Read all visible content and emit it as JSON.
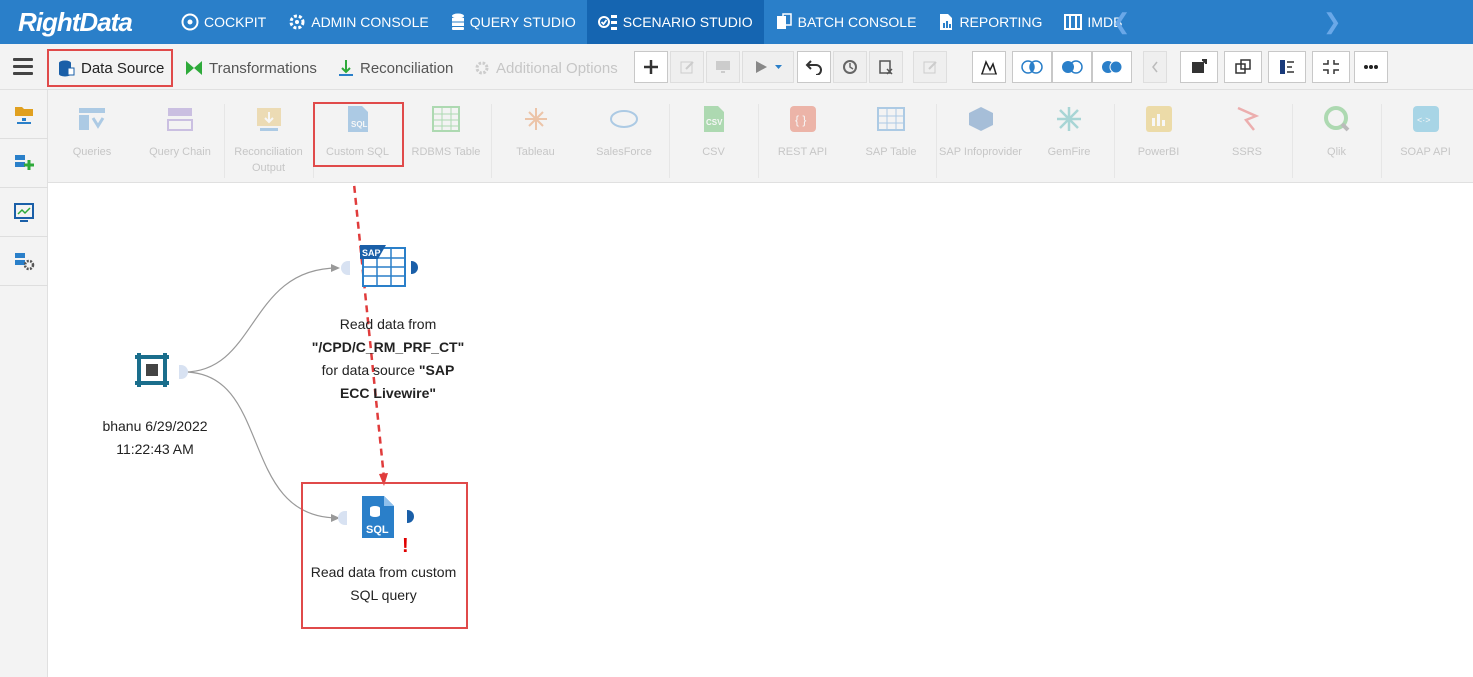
{
  "brand": {
    "logo_text": "RightData"
  },
  "nav": {
    "items": [
      {
        "label": "COCKPIT"
      },
      {
        "label": "ADMIN CONSOLE"
      },
      {
        "label": "QUERY STUDIO"
      },
      {
        "label": "SCENARIO STUDIO"
      },
      {
        "label": "BATCH CONSOLE"
      },
      {
        "label": "REPORTING"
      },
      {
        "label": "IMDB"
      }
    ],
    "active": "SCENARIO STUDIO"
  },
  "toolbar": {
    "data_source": "Data Source",
    "transformations": "Transformations",
    "reconciliation": "Reconciliation",
    "additional_options": "Additional Options"
  },
  "palette": {
    "items": [
      {
        "label": "Queries"
      },
      {
        "label": "Query Chain"
      },
      {
        "label": "Reconciliation Output"
      },
      {
        "label": "Custom SQL"
      },
      {
        "label": "RDBMS Table"
      },
      {
        "label": "Tableau"
      },
      {
        "label": "SalesForce"
      },
      {
        "label": "CSV"
      },
      {
        "label": "REST API"
      },
      {
        "label": "SAP Table"
      },
      {
        "label": "SAP Infoprovider"
      },
      {
        "label": "GemFire"
      },
      {
        "label": "PowerBI"
      },
      {
        "label": "SSRS"
      },
      {
        "label": "Qlik"
      },
      {
        "label": "SOAP API"
      }
    ]
  },
  "canvas": {
    "start_node": {
      "line1": "bhanu 6/29/2022",
      "line2": "11:22:43 AM"
    },
    "sap_node": {
      "prefix": "Read data from",
      "path": "\"/CPD/C_RM_PRF_CT\"",
      "mid": "for data source",
      "source_a": "\"SAP",
      "source_b": "ECC Livewire\""
    },
    "sql_node": {
      "icon_text": "SQL",
      "line1": "Read data from custom",
      "line2": "SQL query",
      "warning": "!"
    }
  },
  "colors": {
    "nav_bg": "#2a7fc9",
    "nav_active": "#1565b1",
    "highlight": "#e04a4a"
  }
}
